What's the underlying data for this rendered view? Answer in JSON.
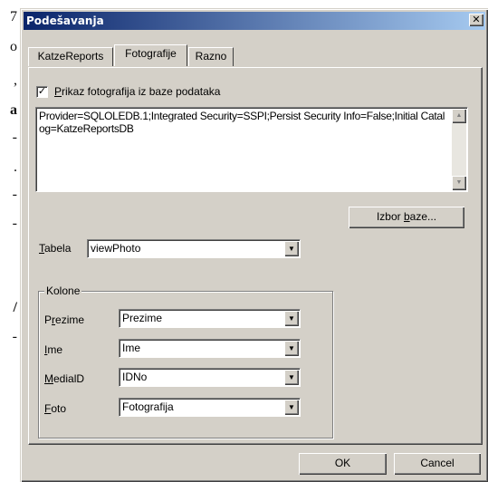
{
  "background": {
    "fragments": [
      "7",
      "o",
      ",",
      "a",
      "-",
      ".",
      "-",
      "-",
      "/",
      "-"
    ]
  },
  "dialog": {
    "title": "Podešavanja",
    "close_glyph": "✕"
  },
  "tabs": [
    {
      "label": "KatzeReports",
      "active": false
    },
    {
      "label": "Fotografije",
      "active": true
    },
    {
      "label": "Razno",
      "active": false
    }
  ],
  "checkbox": {
    "checked": true,
    "check_glyph": "✓",
    "label_accel": "P",
    "label_rest": "rikaz fotografija iz baze podataka"
  },
  "connection_string": "Provider=SQLOLEDB.1;Integrated Security=SSPI;Persist Security Info=False;Initial Catalog=KatzeReportsDB",
  "scroll": {
    "up_glyph": "▲",
    "down_glyph": "▼"
  },
  "izbor_button": {
    "label_pre": "Izbor ",
    "label_accel": "b",
    "label_post": "aze..."
  },
  "tabela": {
    "label_accel": "T",
    "label_rest": "abela",
    "value": "viewPhoto",
    "arrow": "▼"
  },
  "kolone": {
    "title": "Kolone",
    "fields": [
      {
        "label_pre": "P",
        "label_accel": "r",
        "label_post": "ezime",
        "value": "Prezime"
      },
      {
        "label_pre": "",
        "label_accel": "I",
        "label_post": "me",
        "value": "Ime"
      },
      {
        "label_pre": "",
        "label_accel": "M",
        "label_post": "edialD",
        "value": "IDNo"
      },
      {
        "label_pre": "",
        "label_accel": "F",
        "label_post": "oto",
        "value": "Fotografija"
      }
    ],
    "arrow": "▼"
  },
  "buttons": {
    "ok": "OK",
    "cancel": "Cancel"
  }
}
